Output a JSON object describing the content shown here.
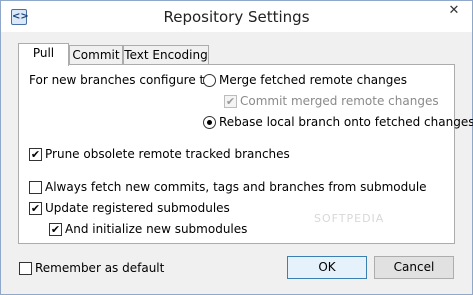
{
  "window": {
    "title": "Repository Settings",
    "close": "✕"
  },
  "tabs": [
    {
      "label": "Pull",
      "active": true
    },
    {
      "label": "Commit",
      "active": false
    },
    {
      "label": "Text Encoding",
      "active": false
    }
  ],
  "pull": {
    "branch_config_label": "For new branches configure to:",
    "radio_merge": {
      "label": "Merge fetched remote changes",
      "selected": false
    },
    "commit_merged": {
      "label": "Commit merged remote changes",
      "checked": true,
      "disabled": true
    },
    "radio_rebase": {
      "label": "Rebase local branch onto fetched changes",
      "selected": true
    },
    "prune": {
      "label": "Prune obsolete remote tracked branches",
      "checked": true
    },
    "always_fetch": {
      "label": "Always fetch new commits, tags and branches from submodule",
      "checked": false
    },
    "update_submodules": {
      "label": "Update registered submodules",
      "checked": true
    },
    "init_submodules": {
      "label": "And initialize new submodules",
      "checked": true
    }
  },
  "footer": {
    "remember_default": {
      "label": "Remember as default",
      "checked": false
    },
    "ok_label": "OK",
    "cancel_label": "Cancel"
  },
  "watermark": "SOFTPEDIA",
  "colors": {
    "window_border": "#8fa8c9",
    "default_button_border": "#3c7fb1"
  }
}
